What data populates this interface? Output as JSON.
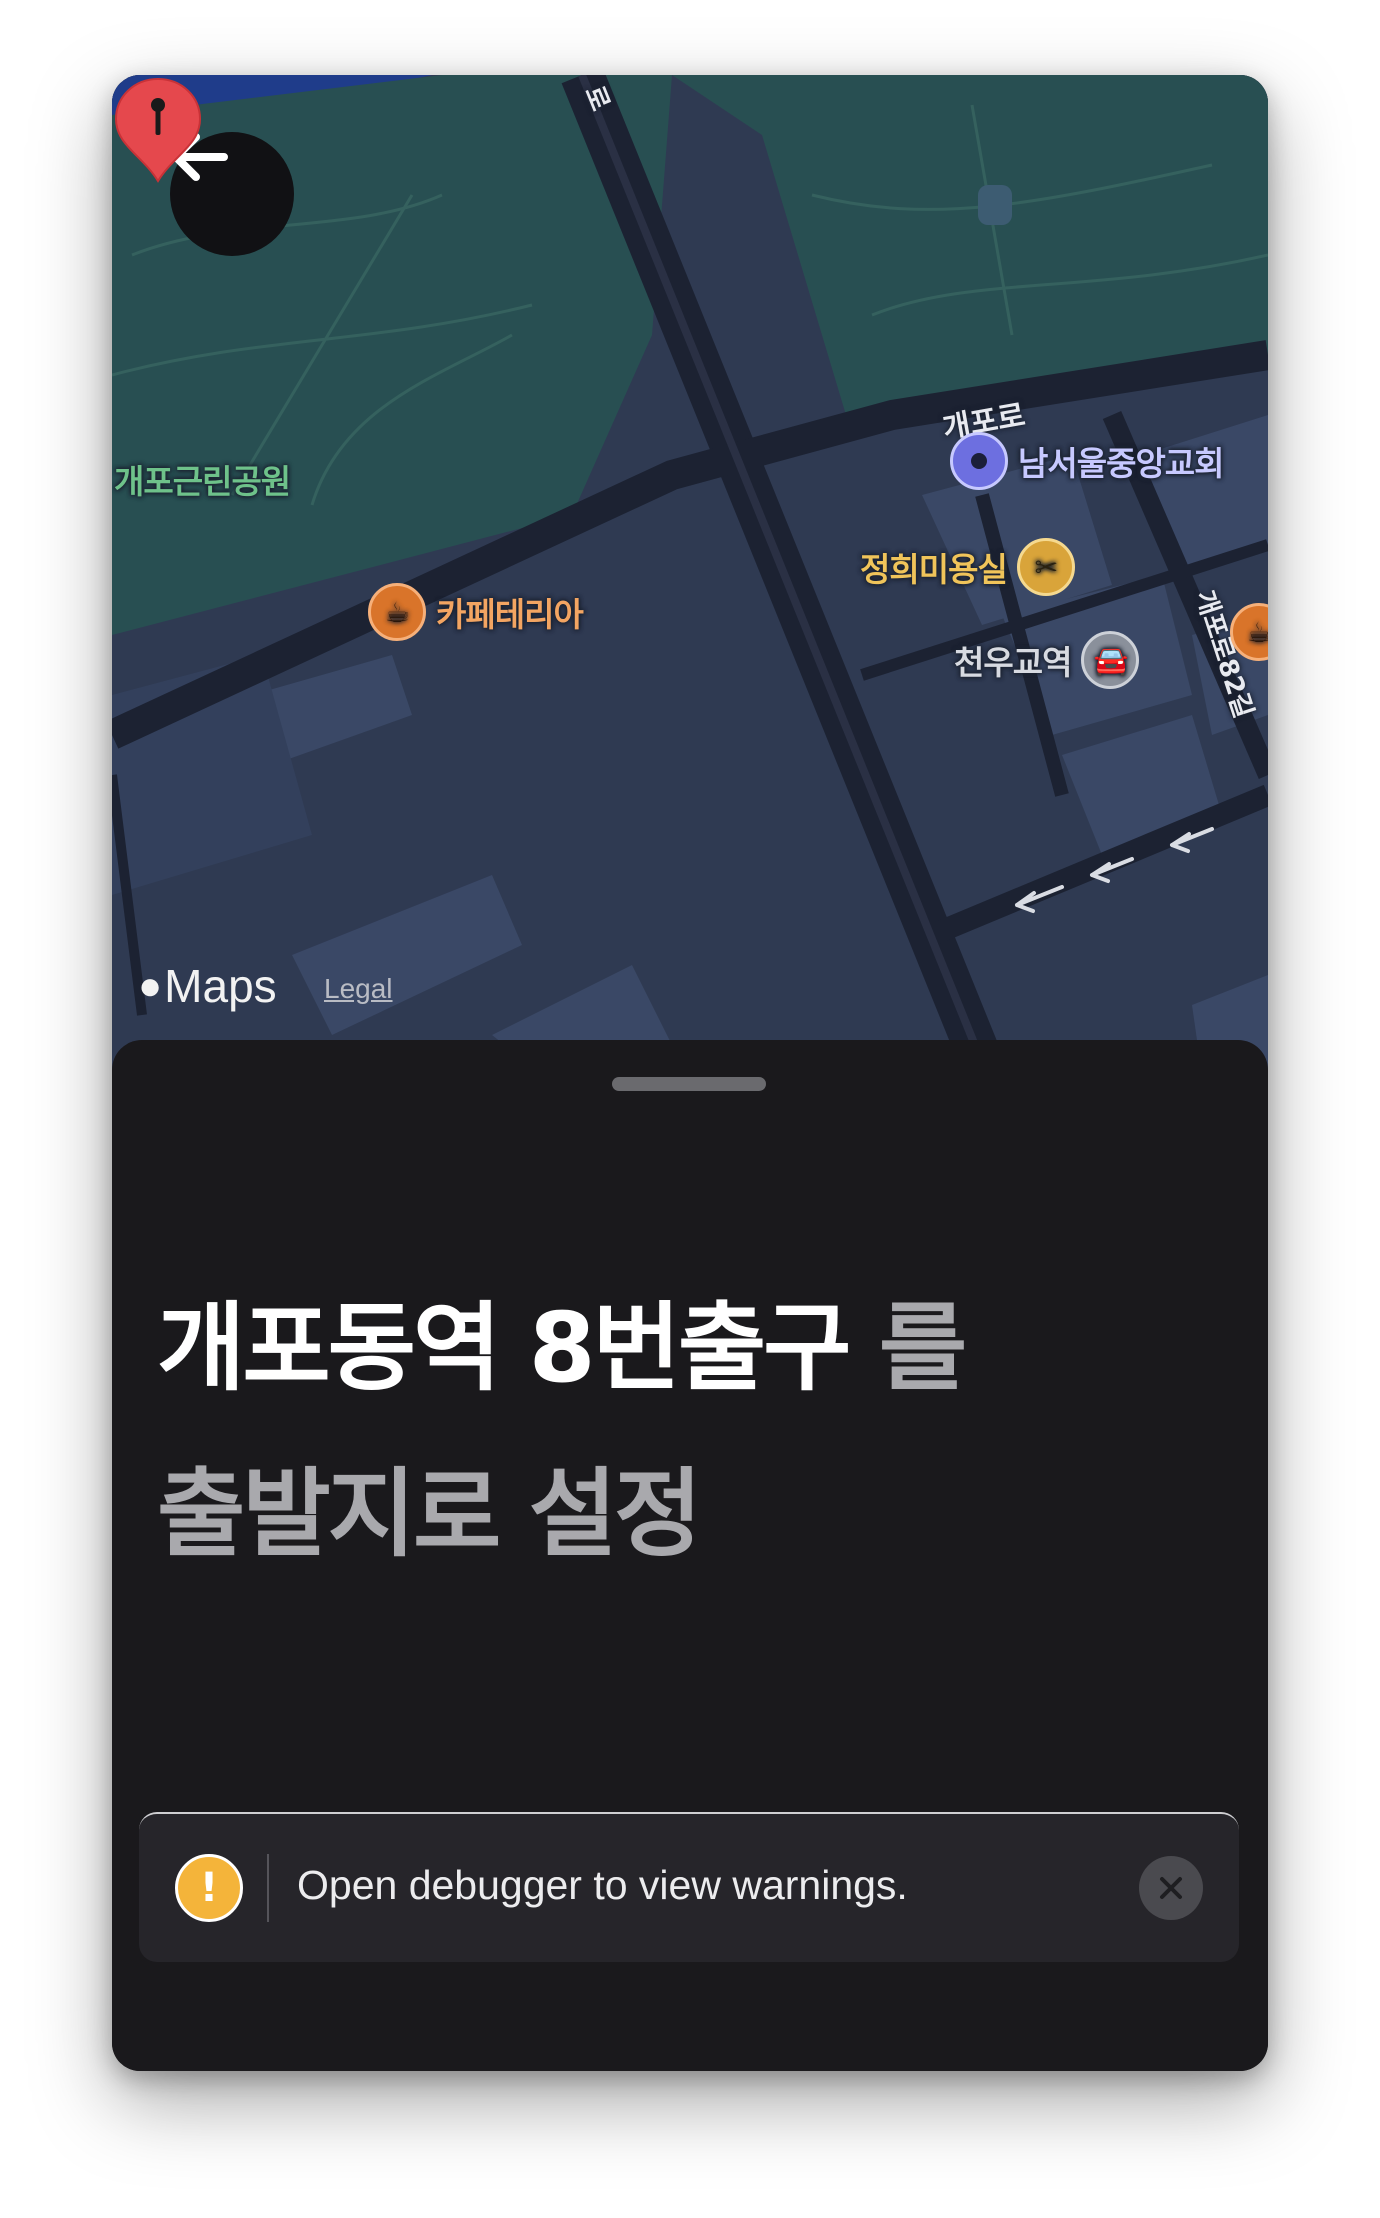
{
  "map": {
    "road_labels": [
      "개포로",
      "개포로82길",
      "로"
    ],
    "park_label": "개포근린공원",
    "pois": [
      {
        "name": "남서울중앙교회",
        "icon": "church-icon",
        "color": "#8e8ff0"
      },
      {
        "name": "정희미용실",
        "icon": "salon-icon",
        "color": "#e8b64a"
      },
      {
        "name": "카페테리아",
        "icon": "cafe-icon",
        "color": "#e98a3c"
      },
      {
        "name": "천우교역",
        "icon": "car-icon",
        "color": "#9aa0aa"
      }
    ],
    "attribution": {
      "brand": "Maps",
      "legal": "Legal"
    },
    "pin_color": "#e5484d"
  },
  "header": {
    "back_icon": "arrow-left-icon"
  },
  "sheet": {
    "title_bold": "개포동역 8번출구",
    "title_rest": "를",
    "subtitle": "출발지로 설정"
  },
  "warning": {
    "icon": "exclamation-icon",
    "text": "Open debugger to view warnings.",
    "close_icon": "close-icon",
    "accent": "#f4b43a"
  }
}
